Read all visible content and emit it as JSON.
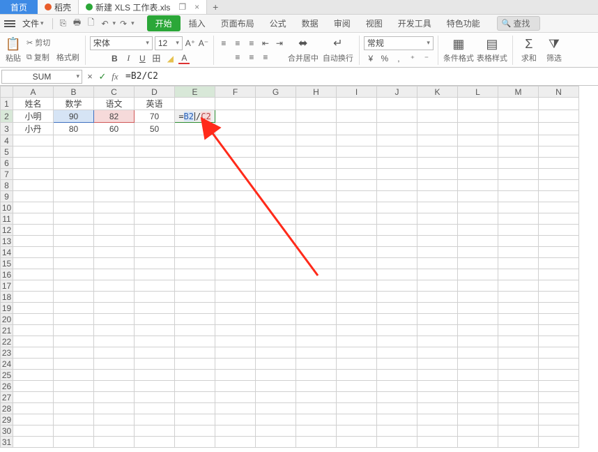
{
  "tabs": {
    "home": "首页",
    "docs": [
      {
        "label": "稻壳",
        "dot_color": "#e85c2a",
        "active": false
      },
      {
        "label": "新建 XLS 工作表.xls",
        "dot_color": "#2ba738",
        "active": true
      }
    ],
    "close_glyph": "×",
    "plus_glyph": "+",
    "restore_glyph": "❐"
  },
  "menubar": {
    "file_label": "文件",
    "drop_glyph": "▾",
    "tabs": [
      "开始",
      "插入",
      "页面布局",
      "公式",
      "数据",
      "审阅",
      "视图",
      "开发工具",
      "特色功能"
    ],
    "active_tab_index": 0,
    "search_label": "查找",
    "search_glyph": "🔍",
    "quickbar": {
      "save": "⎘",
      "print": "🖶",
      "preview": "🗋",
      "undo": "↶",
      "redo": "↷"
    }
  },
  "ribbon": {
    "paste_label": "粘贴",
    "paste_glyph": "📋",
    "cut_label": "剪切",
    "cut_glyph": "✂",
    "copy_label": "复制",
    "copy_glyph": "⧉",
    "fmtpaint_label": "格式刷",
    "font_name": "宋体",
    "font_size": "12",
    "font_btns": {
      "bold": "B",
      "italic": "I",
      "underline": "U",
      "border": "田",
      "fill": "◢",
      "fontcolor": "A"
    },
    "inc_font": "A⁺",
    "dec_font": "A⁻",
    "align": {
      "l": "≡",
      "c": "≡",
      "r": "≡",
      "t": "≡",
      "m": "≡",
      "b": "≡",
      "indL": "⇤",
      "indR": "⇥",
      "wrap_label": "自动换行",
      "merge_label": "合并居中"
    },
    "numfmt": "常规",
    "currency": "¥",
    "percent": "%",
    "comma": ",",
    "inc_dec": "⁺",
    "dec_dec": "⁻",
    "cond_label": "条件格式",
    "styles_label": "表格样式",
    "autosum_label": "求和",
    "filter_label": "筛选",
    "glyph_sigma": "Σ",
    "glyph_funnel": "⧩",
    "glyph_grid": "▦",
    "glyph_table": "▤"
  },
  "formula_bar": {
    "name_box": "SUM",
    "cancel_glyph": "×",
    "accept_glyph": "✓",
    "fx_glyph": "fx",
    "formula_text": "=B2/C2"
  },
  "sheet": {
    "columns": [
      "A",
      "B",
      "C",
      "D",
      "E",
      "F",
      "G",
      "H",
      "I",
      "J",
      "K",
      "L",
      "M",
      "N"
    ],
    "row_count": 31,
    "active_col": "E",
    "active_row": 2,
    "headers": {
      "A": "姓名",
      "B": "数学",
      "C": "语文",
      "D": "英语"
    },
    "rows": [
      {
        "A": "小明",
        "B": "90",
        "C": "82",
        "D": "70"
      },
      {
        "A": "小丹",
        "B": "80",
        "C": "60",
        "D": "50"
      }
    ],
    "edit_cell": {
      "prefix": "=",
      "tokB": "B2",
      "sep": "/",
      "tokC": "C2"
    }
  },
  "chart_data": {
    "type": "table",
    "columns": [
      "姓名",
      "数学",
      "语文",
      "英语"
    ],
    "rows": [
      [
        "小明",
        90,
        82,
        70
      ],
      [
        "小丹",
        80,
        60,
        50
      ]
    ]
  }
}
